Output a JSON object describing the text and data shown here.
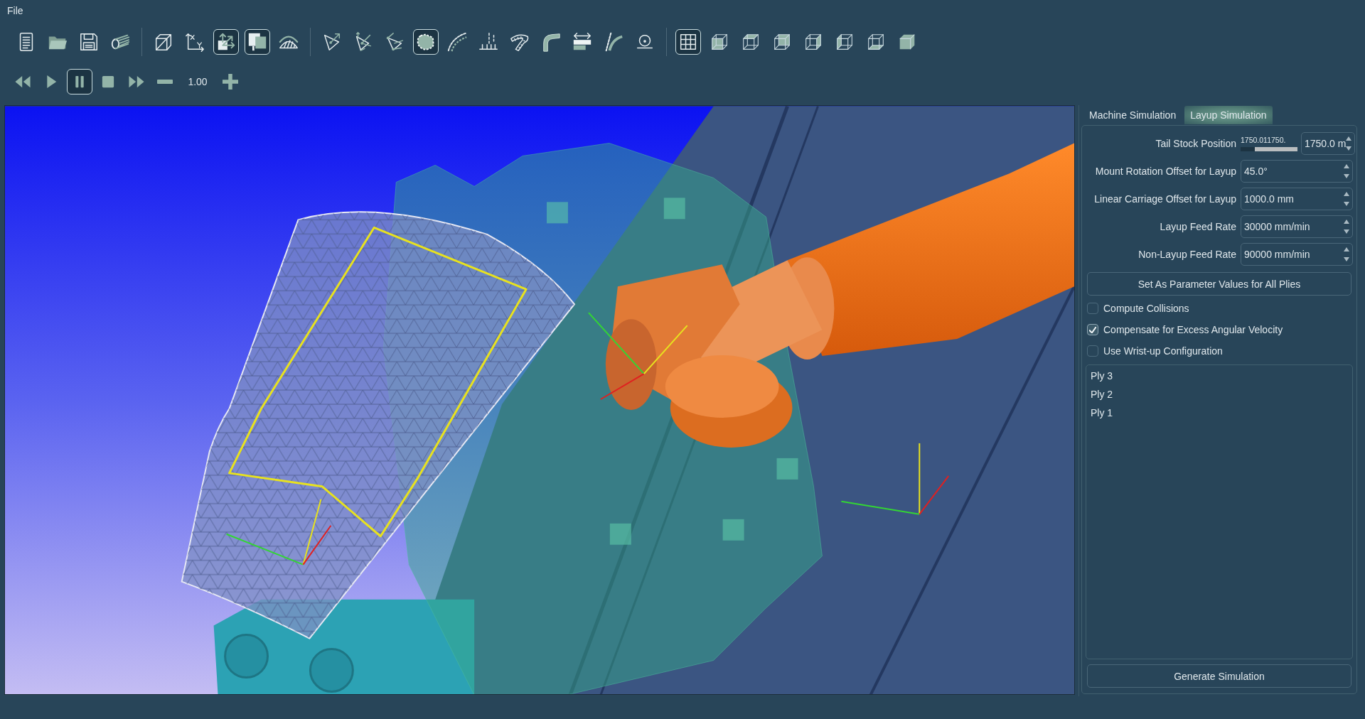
{
  "menu_bar": {
    "items": [
      "File"
    ]
  },
  "toolbar": {
    "groups": [
      [
        {
          "selected": false
        },
        {
          "selected": false
        },
        {
          "selected": false
        },
        {
          "selected": false
        }
      ],
      [
        {
          "selected": false
        },
        {
          "selected": false
        },
        {
          "selected": true
        },
        {
          "selected": true
        },
        {
          "selected": false
        }
      ],
      [
        {
          "selected": false
        },
        {
          "selected": false
        },
        {
          "selected": false
        },
        {
          "selected": true
        },
        {
          "selected": false
        },
        {
          "selected": false
        },
        {
          "selected": false
        },
        {
          "selected": false
        },
        {
          "selected": false
        },
        {
          "selected": false
        },
        {
          "selected": false
        }
      ],
      [
        {
          "selected": true
        },
        {
          "selected": false
        },
        {
          "selected": false
        },
        {
          "selected": false
        },
        {
          "selected": false
        },
        {
          "selected": false
        },
        {
          "selected": false
        },
        {
          "selected": false
        }
      ]
    ]
  },
  "playback": {
    "buttons": [
      {
        "selected": false
      },
      {
        "selected": false
      },
      {
        "selected": true
      },
      {
        "selected": false
      },
      {
        "selected": false
      }
    ],
    "speed": "1.00"
  },
  "tabs": [
    {
      "label": "Machine Simulation",
      "selected": false
    },
    {
      "label": "Layup Simulation",
      "selected": true
    }
  ],
  "parameters": [
    {
      "kind": "slider",
      "label": "Tail Stock Position",
      "range_text": "1750.011750.",
      "level": 0.25,
      "value": "1750.0 m"
    },
    {
      "kind": "spinbox",
      "label": "Mount Rotation Offset for Layup",
      "value": "45.0°"
    },
    {
      "kind": "spinbox",
      "label": "Linear Carriage Offset for Layup",
      "value": "1000.0 mm"
    },
    {
      "kind": "spinbox",
      "label": "Layup Feed Rate",
      "value": "30000 mm/min"
    },
    {
      "kind": "spinbox",
      "label": "Non-Layup Feed Rate",
      "value": "90000 mm/min"
    }
  ],
  "set_all_button": "Set As Parameter Values for All Plies",
  "options": [
    {
      "label": "Compute Collisions",
      "checked": false
    },
    {
      "label": "Compensate for Excess Angular Velocity",
      "checked": true
    },
    {
      "label": "Use Wrist-up Configuration",
      "checked": false
    }
  ],
  "plies": [
    {
      "label": "Ply 3",
      "selected": false
    },
    {
      "label": "Ply 2",
      "selected": false
    },
    {
      "label": "Ply 1",
      "selected": false
    }
  ],
  "generate_button": "Generate Simulation"
}
